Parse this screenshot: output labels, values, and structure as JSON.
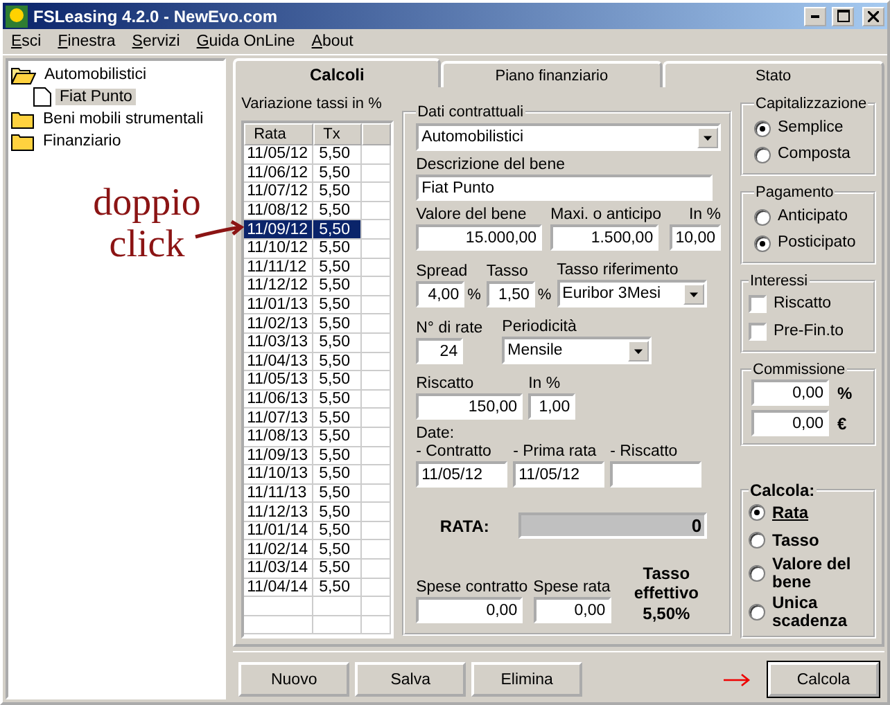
{
  "window": {
    "title": "FSLeasing 4.2.0 - NewEvo.com"
  },
  "menu": [
    {
      "label": "Esci"
    },
    {
      "label": "Finestra"
    },
    {
      "label": "Servizi"
    },
    {
      "label": "Guida OnLine"
    },
    {
      "label": "About"
    }
  ],
  "tree": [
    {
      "kind": "folder",
      "label": "Automobilistici",
      "expanded": true,
      "selected": false,
      "children": [
        {
          "kind": "file",
          "label": "Fiat Punto",
          "selected": true
        }
      ]
    },
    {
      "kind": "folder",
      "label": "Beni mobili strumentali",
      "expanded": false,
      "selected": false
    },
    {
      "kind": "folder",
      "label": "Finanziario",
      "expanded": false,
      "selected": false
    }
  ],
  "tabs": [
    {
      "label": "Calcoli",
      "selected": true
    },
    {
      "label": "Piano finanziario",
      "selected": false
    },
    {
      "label": "Stato",
      "selected": false
    }
  ],
  "rate_table": {
    "title": "Variazione tassi in %",
    "columns": [
      "Rata",
      "Tx"
    ],
    "rows": [
      {
        "rata": "11/05/12",
        "tx": "5,50",
        "selected": false
      },
      {
        "rata": "11/06/12",
        "tx": "5,50",
        "selected": false
      },
      {
        "rata": "11/07/12",
        "tx": "5,50",
        "selected": false
      },
      {
        "rata": "11/08/12",
        "tx": "5,50",
        "selected": false
      },
      {
        "rata": "11/09/12",
        "tx": "5,50",
        "selected": true
      },
      {
        "rata": "11/10/12",
        "tx": "5,50",
        "selected": false
      },
      {
        "rata": "11/11/12",
        "tx": "5,50",
        "selected": false
      },
      {
        "rata": "11/12/12",
        "tx": "5,50",
        "selected": false
      },
      {
        "rata": "11/01/13",
        "tx": "5,50",
        "selected": false
      },
      {
        "rata": "11/02/13",
        "tx": "5,50",
        "selected": false
      },
      {
        "rata": "11/03/13",
        "tx": "5,50",
        "selected": false
      },
      {
        "rata": "11/04/13",
        "tx": "5,50",
        "selected": false
      },
      {
        "rata": "11/05/13",
        "tx": "5,50",
        "selected": false
      },
      {
        "rata": "11/06/13",
        "tx": "5,50",
        "selected": false
      },
      {
        "rata": "11/07/13",
        "tx": "5,50",
        "selected": false
      },
      {
        "rata": "11/08/13",
        "tx": "5,50",
        "selected": false
      },
      {
        "rata": "11/09/13",
        "tx": "5,50",
        "selected": false
      },
      {
        "rata": "11/10/13",
        "tx": "5,50",
        "selected": false
      },
      {
        "rata": "11/11/13",
        "tx": "5,50",
        "selected": false
      },
      {
        "rata": "11/12/13",
        "tx": "5,50",
        "selected": false
      },
      {
        "rata": "11/01/14",
        "tx": "5,50",
        "selected": false
      },
      {
        "rata": "11/02/14",
        "tx": "5,50",
        "selected": false
      },
      {
        "rata": "11/03/14",
        "tx": "5,50",
        "selected": false
      },
      {
        "rata": "11/04/14",
        "tx": "5,50",
        "selected": false
      }
    ]
  },
  "contract": {
    "legend": "Dati contrattuali",
    "category": {
      "value": "Automobilistici"
    },
    "description": {
      "label": "Descrizione del bene",
      "value": "Fiat Punto"
    },
    "asset_value": {
      "label": "Valore del bene",
      "value": "15.000,00"
    },
    "maxi": {
      "label": "Maxi. o anticipo",
      "value": "1.500,00"
    },
    "maxi_pct": {
      "label": "In %",
      "value": "10,00"
    },
    "spread": {
      "label": "Spread",
      "value": "4,00",
      "unit": "%"
    },
    "rate": {
      "label": "Tasso",
      "value": "1,50",
      "unit": "%"
    },
    "reference": {
      "label": "Tasso riferimento",
      "value": "Euribor 3Mesi"
    },
    "installments": {
      "label": "N° di rate",
      "value": "24"
    },
    "periodicity": {
      "label": "Periodicità",
      "value": "Mensile"
    },
    "buyout": {
      "label": "Riscatto",
      "value": "150,00"
    },
    "buyout_pct": {
      "label": "In %",
      "value": "1,00"
    },
    "dates": {
      "label": "Date:",
      "fields": [
        {
          "label": "- Contratto",
          "value": "11/05/12"
        },
        {
          "label": "- Prima rata",
          "value": "11/05/12"
        },
        {
          "label": "- Riscatto"
        }
      ]
    },
    "result": {
      "label": "RATA:",
      "value": "0"
    },
    "contract_fees": {
      "label": "Spese contratto",
      "value": "0,00"
    },
    "installment_fees": {
      "label": "Spese rata",
      "value": "0,00"
    },
    "effective_rate": {
      "label": "Tasso effettivo",
      "value": "5,50%"
    }
  },
  "capitalization": {
    "legend": "Capitalizzazione",
    "options": [
      {
        "label": "Semplice",
        "selected": true
      },
      {
        "label": "Composta",
        "selected": false
      }
    ]
  },
  "payment": {
    "legend": "Pagamento",
    "options": [
      {
        "label": "Anticipato",
        "selected": false
      },
      {
        "label": "Posticipato",
        "selected": true
      }
    ]
  },
  "interest": {
    "legend": "Interessi",
    "checks": [
      {
        "label": "Riscatto",
        "checked": false
      },
      {
        "label": "Pre-Fin.to",
        "checked": false
      }
    ]
  },
  "commission": {
    "legend": "Commissione",
    "fields": [
      {
        "value": "0,00",
        "unit": "%"
      },
      {
        "value": "0,00",
        "unit": "€"
      }
    ]
  },
  "compute": {
    "legend": "Calcola:",
    "options": [
      {
        "label": "Rata",
        "selected": true
      },
      {
        "label": "Tasso",
        "selected": false
      },
      {
        "label": "Valore del bene",
        "selected": false
      },
      {
        "label": "Unica scadenza",
        "selected": false
      }
    ]
  },
  "buttons": [
    "Nuovo",
    "Salva",
    "Elimina"
  ],
  "primary_button": "Calcola",
  "annotation": {
    "text": "doppio click"
  }
}
